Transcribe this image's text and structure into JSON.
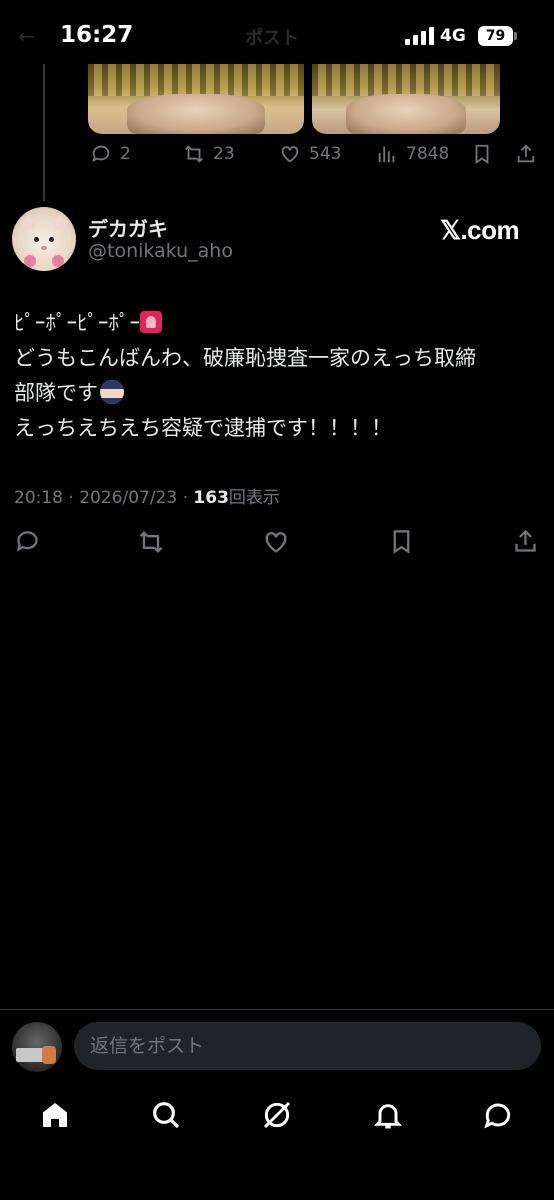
{
  "status_bar": {
    "time": "16:27",
    "network": "4G",
    "battery": "79",
    "ghost_title": "ポスト",
    "ghost_back": "←"
  },
  "previous_post": {
    "reply_count": "2",
    "retweet_count": "23",
    "like_count": "543",
    "view_count": "7848"
  },
  "post": {
    "display_name": "デカガキ",
    "handle": "@tonikaku_aho",
    "source_badge": "𝕏.com",
    "lines": [
      "ﾋﾟｰﾎﾟｰﾋﾟｰﾎﾟｰ",
      "どうもこんばんわ、破廉恥捜査一家のえっち取締",
      "部隊です",
      "えっちえちえち容疑で逮捕です！！！！"
    ],
    "emojis": {
      "line0": "siren-icon",
      "line2": "police-officer-icon"
    },
    "timestamp": "20:18 · 2026/07/23 · ",
    "views": "163",
    "views_label": "回表示"
  },
  "reply_bar": {
    "placeholder": "返信をポスト"
  },
  "bottom_nav": [
    "home-icon",
    "search-icon",
    "grok-icon",
    "notifications-icon",
    "messages-icon"
  ],
  "colors": {
    "background": "#000000",
    "text": "#e7e9ea",
    "muted": "#71767b",
    "input_bg": "#202327",
    "divider": "#2f3336"
  }
}
